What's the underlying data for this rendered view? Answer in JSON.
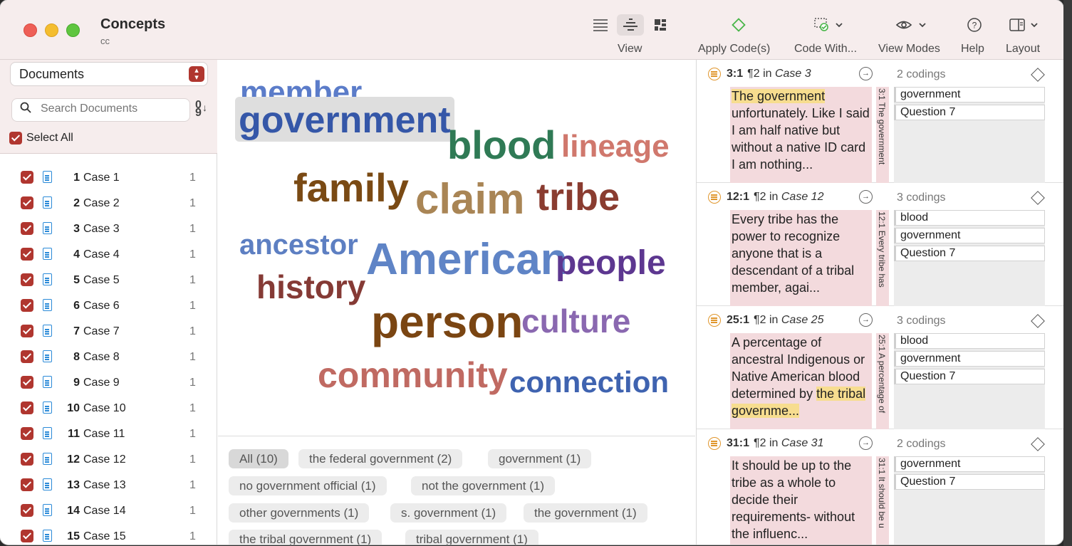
{
  "window": {
    "title": "Concepts",
    "subtitle": "cc"
  },
  "toolbar": {
    "view_label": "View",
    "apply_codes_label": "Apply Code(s)",
    "code_with_label": "Code With...",
    "view_modes_label": "View Modes",
    "help_label": "Help",
    "layout_label": "Layout"
  },
  "sidebar": {
    "selector_value": "Documents",
    "search_placeholder": "Search Documents",
    "select_all_label": "Select All",
    "documents": [
      {
        "num": "1",
        "name": "Case 1",
        "count": "1"
      },
      {
        "num": "2",
        "name": "Case 2",
        "count": "1"
      },
      {
        "num": "3",
        "name": "Case 3",
        "count": "1"
      },
      {
        "num": "4",
        "name": "Case 4",
        "count": "1"
      },
      {
        "num": "5",
        "name": "Case 5",
        "count": "1"
      },
      {
        "num": "6",
        "name": "Case 6",
        "count": "1"
      },
      {
        "num": "7",
        "name": "Case 7",
        "count": "1"
      },
      {
        "num": "8",
        "name": "Case 8",
        "count": "1"
      },
      {
        "num": "9",
        "name": "Case 9",
        "count": "1"
      },
      {
        "num": "10",
        "name": "Case 10",
        "count": "1"
      },
      {
        "num": "11",
        "name": "Case 11",
        "count": "1"
      },
      {
        "num": "12",
        "name": "Case 12",
        "count": "1"
      },
      {
        "num": "13",
        "name": "Case 13",
        "count": "1"
      },
      {
        "num": "14",
        "name": "Case 14",
        "count": "1"
      },
      {
        "num": "15",
        "name": "Case 15",
        "count": "1"
      }
    ]
  },
  "cloud": {
    "selected_word": "government",
    "words": [
      {
        "text": "member",
        "color": "#5b7cc9"
      },
      {
        "text": "government",
        "color": "#3557a8"
      },
      {
        "text": "blood",
        "color": "#2f7a55"
      },
      {
        "text": "lineage",
        "color": "#d0786d"
      },
      {
        "text": "family",
        "color": "#7a4a14"
      },
      {
        "text": "claim",
        "color": "#a98555"
      },
      {
        "text": "tribe",
        "color": "#8a3c30"
      },
      {
        "text": "ancestor",
        "color": "#5d7fc2"
      },
      {
        "text": "American",
        "color": "#5f84c6"
      },
      {
        "text": "people",
        "color": "#5d3790"
      },
      {
        "text": "history",
        "color": "#853a35"
      },
      {
        "text": "person",
        "color": "#7a4512"
      },
      {
        "text": "culture",
        "color": "#8a68b0"
      },
      {
        "text": "community",
        "color": "#c06a62"
      },
      {
        "text": "connection",
        "color": "#3f63b0"
      }
    ]
  },
  "phrases": [
    {
      "label": "All (10)",
      "active": true
    },
    {
      "label": "the federal government (2)"
    },
    {
      "label": "government (1)"
    },
    {
      "label": "no government official (1)"
    },
    {
      "label": "not the government (1)"
    },
    {
      "label": "other governments (1)"
    },
    {
      "label": "s. government (1)"
    },
    {
      "label": "the government (1)"
    },
    {
      "label": "the tribal government (1)"
    },
    {
      "label": "tribal government (1)"
    }
  ],
  "quotes": [
    {
      "id": "3:1",
      "para": "¶2 in",
      "case": "Case 3",
      "codings": "2 codings",
      "highlight": "The government",
      "text": " unfortunately. Like I said I am half native but without a native ID card I am nothing...",
      "vertical": "3:1 The government",
      "codes": [
        "government",
        "Question 7"
      ]
    },
    {
      "id": "12:1",
      "para": "¶2 in",
      "case": "Case 12",
      "codings": "3 codings",
      "highlight": "",
      "text": "Every tribe has the power to recognize anyone that is a descendant of a tribal member, agai...",
      "vertical": "12:1 Every tribe has",
      "codes": [
        "blood",
        "government",
        "Question 7"
      ]
    },
    {
      "id": "25:1",
      "para": "¶2 in",
      "case": "Case 25",
      "codings": "3 codings",
      "highlight": "",
      "text": "A percentage of ancestral Indigenous or Native American blood determined by ",
      "tail_highlight": "the tribal governme...",
      "vertical": "25:1 A percentage of",
      "codes": [
        "blood",
        "government",
        "Question 7"
      ]
    },
    {
      "id": "31:1",
      "para": "¶2 in",
      "case": "Case 31",
      "codings": "2 codings",
      "highlight": "",
      "text": "It should be up to the tribe as a whole to decide their requirements- without the influenc...",
      "vertical": "31:1 It should be u",
      "codes": [
        "government",
        "Question 7"
      ]
    }
  ]
}
